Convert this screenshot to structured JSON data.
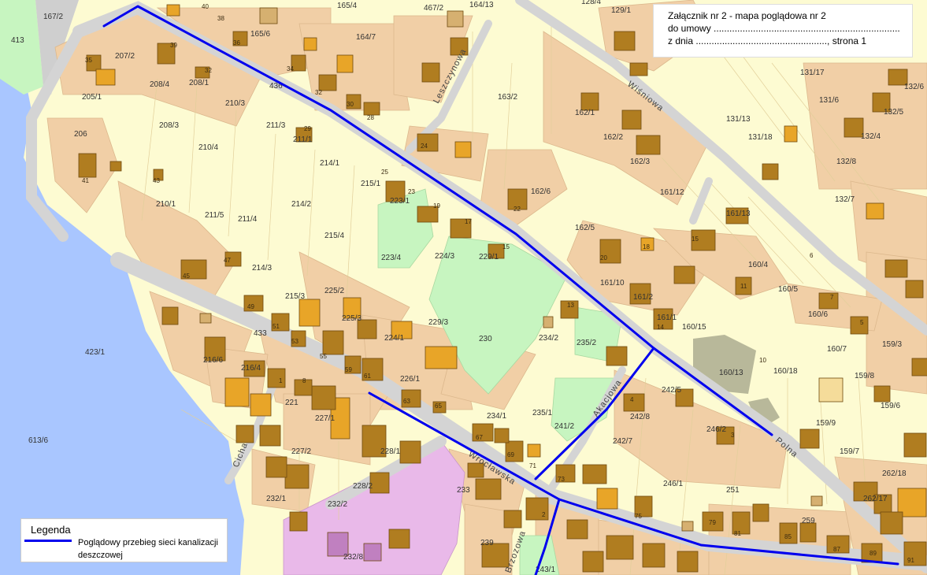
{
  "annex": {
    "line1": "Załącznik nr 2 - mapa poglądowa nr 2",
    "line2": "do umowy .......................................................................",
    "line3": "z dnia .................................................., strona 1"
  },
  "legend": {
    "title": "Legenda",
    "item": "Poglądowy przebieg sieci kanalizacji deszczowej"
  },
  "colors": {
    "background": "#fdfbd2",
    "parcel_built": "#f1cfa6",
    "green_area": "#c7f5c0",
    "water": "#a9c6ff",
    "road": "#d4d4d4",
    "building": "#b07d20",
    "building_light": "#e8a528",
    "industrial": "#e9b9e9",
    "network_line": "#0000ee"
  },
  "streets": [
    "Leszczynowa",
    "Wiśniowa",
    "Wrocławska",
    "Polna",
    "Cicha",
    "Akacjowa",
    "Brzozowa"
  ],
  "parcels": [
    "167/2",
    "165/4",
    "467/2",
    "164/13",
    "128/4",
    "129/1",
    "413",
    "165/6",
    "164/7",
    "207/2",
    "208/4",
    "208/1",
    "210/3",
    "436",
    "205/1",
    "208/3",
    "211/3",
    "163/2",
    "162/1",
    "162/2",
    "131/13",
    "131/17",
    "131/6",
    "132/6",
    "132/5",
    "131/18",
    "132/4",
    "206",
    "210/4",
    "214/1",
    "211/1",
    "161/12",
    "162/3",
    "162/6",
    "132/8",
    "132/7",
    "210/1",
    "211/5",
    "211/4",
    "214/2",
    "215/1",
    "223/1",
    "223/4",
    "224/3",
    "229/1",
    "161/13",
    "162/5",
    "160/4",
    "215/4",
    "214/3",
    "215/3",
    "225/2",
    "229/3",
    "230",
    "161/10",
    "161/2",
    "161/1",
    "160/5",
    "160/6",
    "423/1",
    "433",
    "225/3",
    "224/1",
    "234/2",
    "235/2",
    "160/15",
    "160/7",
    "159/3",
    "216/6",
    "216/4",
    "221",
    "227/1",
    "226/1",
    "160/13",
    "160/18",
    "159/8",
    "242/5",
    "242/8",
    "246/2",
    "159/6",
    "613/6",
    "227/2",
    "228/1",
    "234/1",
    "235/1",
    "241/2",
    "242/7",
    "159/9",
    "159/7",
    "232/1",
    "232/2",
    "228/2",
    "233",
    "239",
    "246/1",
    "251",
    "262/18",
    "232/8",
    "243/1",
    "259",
    "262/17"
  ],
  "building_numbers": [
    "35",
    "39",
    "36",
    "16",
    "12",
    "32",
    "40",
    "38",
    "34",
    "30",
    "28",
    "24",
    "21",
    "43",
    "41",
    "29",
    "25",
    "23",
    "19",
    "17",
    "15",
    "11",
    "14",
    "45",
    "47",
    "49",
    "51",
    "53",
    "55",
    "59",
    "61",
    "63",
    "65",
    "67",
    "69",
    "71",
    "73",
    "75",
    "79",
    "81",
    "85",
    "87",
    "89",
    "91",
    "20",
    "18",
    "13",
    "10",
    "8",
    "7",
    "6",
    "5",
    "4",
    "3",
    "2",
    "1"
  ]
}
